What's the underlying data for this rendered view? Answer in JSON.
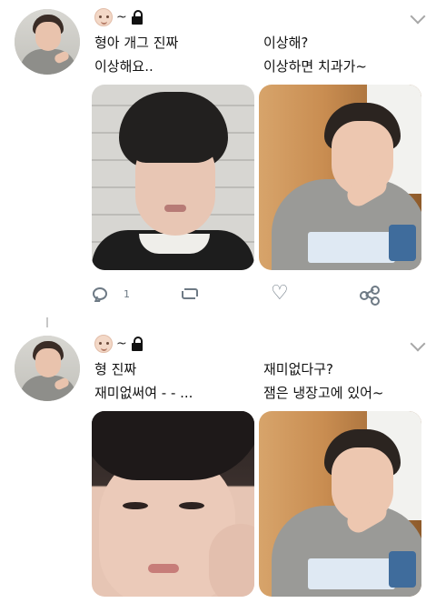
{
  "tweets": [
    {
      "text_left_1": "형아 개그 진짜",
      "text_left_2": "이상해요..",
      "text_right_1": "이상해?",
      "text_right_2": "이상하면 치과가~",
      "actions": {
        "reply_count": "1"
      }
    },
    {
      "text_left_1": "형 진짜",
      "text_left_2": "재미없써여 - - ...",
      "text_right_1": "재미없다구?",
      "text_right_2": "잼은 냉장고에 있어~"
    }
  ],
  "header": {
    "separator": "~"
  },
  "icons": {
    "avatar": "avatar-photo",
    "face_emoji": "baby-face-emoji",
    "lock": "lock-icon",
    "menu": "chevron-down-icon",
    "reply": "reply-icon",
    "retweet": "retweet-icon",
    "like": "heart-icon",
    "share": "share-icon"
  },
  "colors": {
    "icon_gray": "#6e7a85",
    "text": "#111111",
    "background": "#ffffff"
  }
}
